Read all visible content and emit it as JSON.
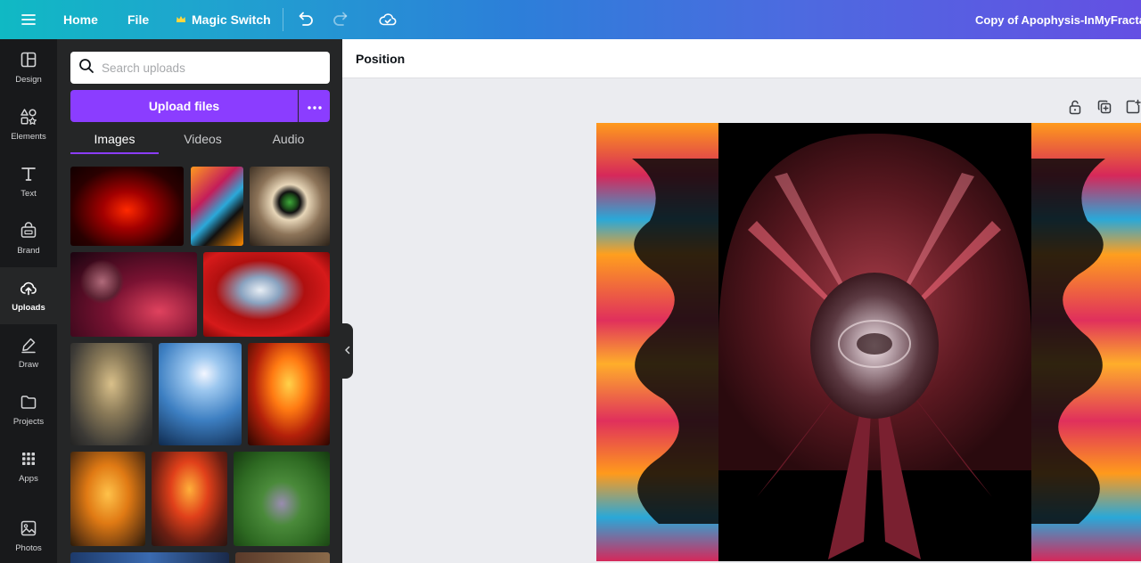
{
  "topbar": {
    "home_label": "Home",
    "file_label": "File",
    "magic_switch_label": "Magic Switch",
    "document_title": "Copy of Apophysis-InMyFractal"
  },
  "rail": {
    "items": [
      {
        "label": "Design",
        "icon": "design-icon"
      },
      {
        "label": "Elements",
        "icon": "elements-icon"
      },
      {
        "label": "Text",
        "icon": "text-icon"
      },
      {
        "label": "Brand",
        "icon": "brand-icon"
      },
      {
        "label": "Uploads",
        "icon": "uploads-icon",
        "active": true
      },
      {
        "label": "Draw",
        "icon": "draw-icon"
      },
      {
        "label": "Projects",
        "icon": "projects-icon"
      },
      {
        "label": "Apps",
        "icon": "apps-icon"
      },
      {
        "label": "Photos",
        "icon": "photos-icon"
      }
    ]
  },
  "panel": {
    "search_placeholder": "Search uploads",
    "upload_button": "Upload files",
    "tabs": [
      {
        "label": "Images",
        "active": true
      },
      {
        "label": "Videos"
      },
      {
        "label": "Audio"
      }
    ]
  },
  "toolbar": {
    "position_label": "Position"
  },
  "colors": {
    "accent": "#8b3dff",
    "rail_bg": "#18191b",
    "panel_bg": "#252627",
    "canvas_bg": "#ebecf0"
  }
}
